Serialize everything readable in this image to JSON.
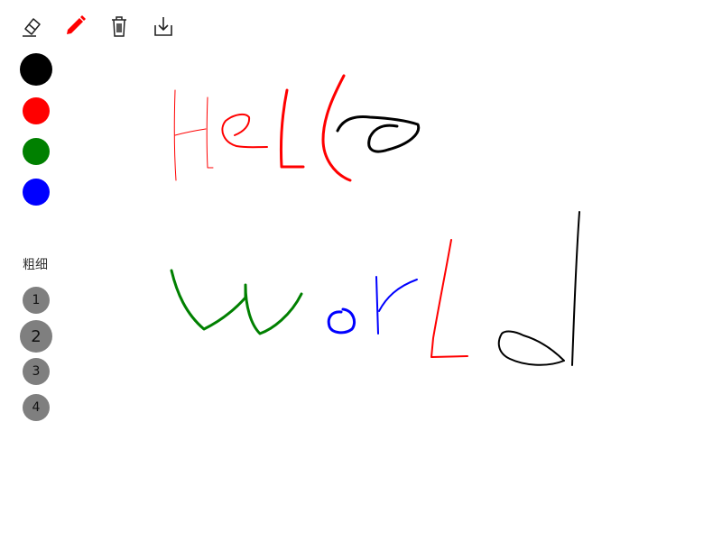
{
  "toolbar": {
    "tools": [
      {
        "id": "eraser",
        "icon": "eraser-icon",
        "active": false
      },
      {
        "id": "pen",
        "icon": "pen-icon",
        "active": true,
        "color": "#ff0000"
      },
      {
        "id": "clear",
        "icon": "trash-icon",
        "active": false
      },
      {
        "id": "save",
        "icon": "download-icon",
        "active": false
      }
    ]
  },
  "colors": [
    {
      "name": "black",
      "hex": "#000000",
      "selected": true
    },
    {
      "name": "red",
      "hex": "#ff0000",
      "selected": false
    },
    {
      "name": "green",
      "hex": "#008000",
      "selected": false
    },
    {
      "name": "blue",
      "hex": "#0000ff",
      "selected": false
    }
  ],
  "sizes": {
    "label": "粗细",
    "options": [
      "1",
      "2",
      "3",
      "4"
    ],
    "selected": "2"
  }
}
